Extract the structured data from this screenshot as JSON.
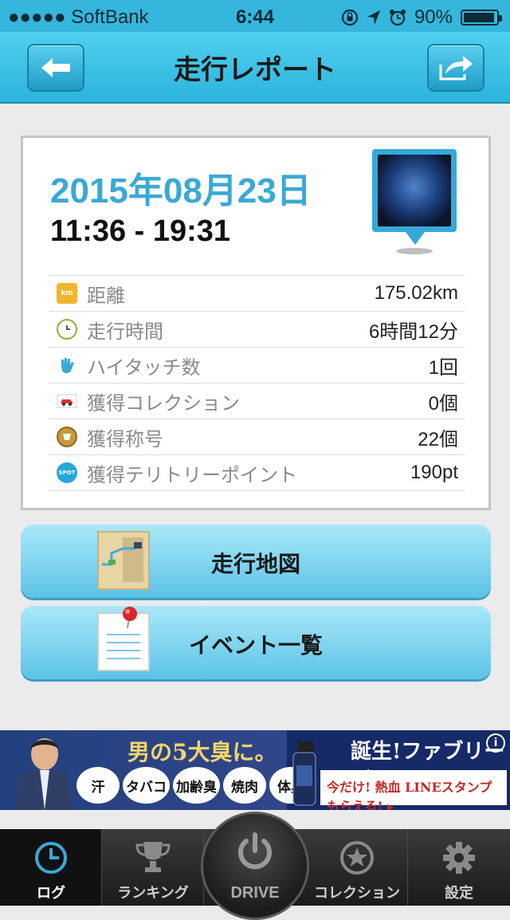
{
  "status": {
    "carrier": "●●●●● SoftBank",
    "time": "6:44",
    "battery": "90%"
  },
  "nav": {
    "title": "走行レポート",
    "back_icon": "back-arrow-icon",
    "share_icon": "share-icon"
  },
  "report": {
    "date": "2015年08月23日",
    "time_range": "11:36 - 19:31",
    "rows": [
      {
        "icon": "km-icon",
        "label": "距離",
        "value": "175.02km"
      },
      {
        "icon": "clock-icon",
        "label": "走行時間",
        "value": "6時間12分"
      },
      {
        "icon": "hand-icon",
        "label": "ハイタッチ数",
        "value": "1回"
      },
      {
        "icon": "car-icon",
        "label": "獲得コレクション",
        "value": "0個"
      },
      {
        "icon": "medal-icon",
        "label": "獲得称号",
        "value": "22個"
      },
      {
        "icon": "spot-icon",
        "label": "獲得テリトリーポイント",
        "value": "190pt"
      }
    ],
    "icon_texts": {
      "km": "km",
      "spot": "SPOT"
    }
  },
  "buttons": {
    "map": "走行地図",
    "events": "イベント一覧"
  },
  "ad": {
    "headline": "男の5大臭に。",
    "chips": [
      "汗",
      "タバコ",
      "加齢臭",
      "焼肉",
      "体臭"
    ],
    "right_title": "誕生!ファブリーズMEN",
    "right_sub": "今だけ! 熱血 LINEスタンプもらえる! ▸",
    "info": "i"
  },
  "tabbar": {
    "log": "ログ",
    "ranking": "ランキング",
    "drive": "DRIVE",
    "collection": "コレクション",
    "settings": "設定",
    "active": "log"
  },
  "colors": {
    "accent": "#3aa9d4",
    "nav_bg": "#35b6dc",
    "button_bg": "#7fd4ef"
  }
}
